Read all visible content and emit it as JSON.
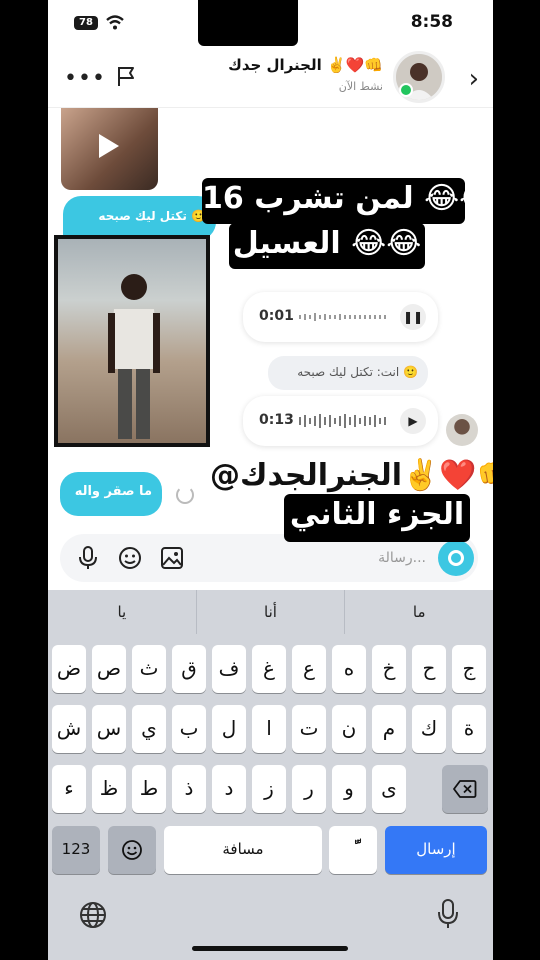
{
  "status": {
    "battery": "78",
    "time": "8:58"
  },
  "top_overlay": {
    "emoji": "😂😂"
  },
  "header": {
    "contact_name": "الجنرال جدك ✌️❤️👊",
    "contact_status": "نشط الآن"
  },
  "chat": {
    "reply_bubble": "تكتل ليك صبحه 🙂",
    "voice_1_time": "0:01",
    "reply_note": "انت: تكتل ليك صبحه 🙂",
    "voice_2_time": "0:13",
    "outgoing_message": "ما صقر واله"
  },
  "overlays": {
    "line1": "لمن تشرب 16 😂😂",
    "line2": "العسيل 😂😂",
    "mention": "@الجنرالجدك✌️❤️👊",
    "line3": "الجزء الثاني"
  },
  "composer": {
    "placeholder": "رسالة..."
  },
  "keyboard": {
    "suggestions": [
      "ما",
      "أنا",
      "يا"
    ],
    "row1": [
      "ض",
      "ص",
      "ث",
      "ق",
      "ف",
      "غ",
      "ع",
      "ه",
      "خ",
      "ح",
      "ج"
    ],
    "row2": [
      "ش",
      "س",
      "ي",
      "ب",
      "ل",
      "ا",
      "ت",
      "ن",
      "م",
      "ك",
      "ة"
    ],
    "row3": [
      "ء",
      "ظ",
      "ط",
      "ذ",
      "د",
      "ز",
      "ر",
      "و",
      "ى"
    ],
    "num_label": "123",
    "space_label": "مسافة",
    "diacritic_label": "ًّ",
    "send_label": "إرسال"
  }
}
